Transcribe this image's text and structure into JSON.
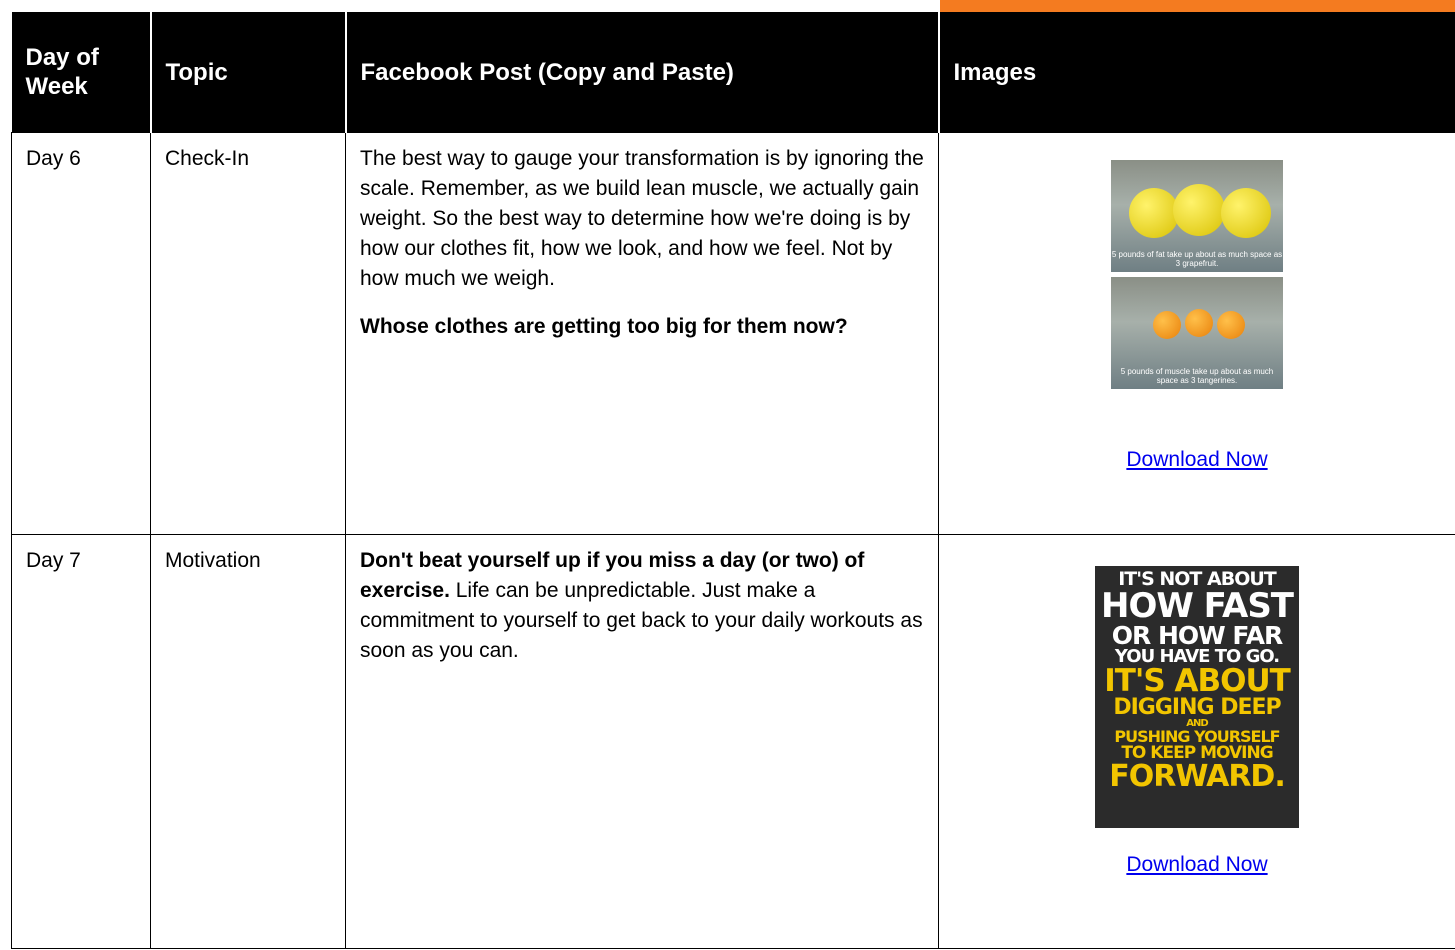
{
  "table": {
    "headers": [
      "Day of Week",
      "Topic",
      "Facebook Post (Copy and Paste)",
      "Images"
    ],
    "rows": [
      {
        "day": "Day 6",
        "topic": "Check-In",
        "post_para1": "The best way to gauge your transformation is by ignoring the scale. Remember, as we build lean muscle, we actually gain weight. So the best way to determine how we're doing is by how our clothes fit, how we look, and how we feel. Not by how much we weigh.",
        "post_para2_bold": "Whose clothes are getting too big for them now?",
        "image_caption_top": "5 pounds of fat take up about as much space as 3 grapefruit.",
        "image_caption_bottom": "5 pounds of muscle take up about as much space as 3 tangerines.",
        "link": "Download Now"
      },
      {
        "day": "Day 7",
        "topic": "Motivation",
        "post_bold": "Don't beat yourself up if you miss a day (or two) of exercise.",
        "post_rest": " Life can be unpredictable. Just make a commitment to yourself to get back to your daily workouts as soon as you can.",
        "poster_lines": [
          "IT'S NOT ABOUT",
          "HOW FAST",
          "OR HOW FAR",
          "YOU HAVE TO GO.",
          "IT'S ABOUT",
          "DIGGING DEEP",
          "AND",
          "PUSHING YOURSELF",
          "TO KEEP MOVING",
          "FORWARD."
        ],
        "link": "Download Now"
      }
    ]
  },
  "colors": {
    "accent": "#f47b20",
    "header_bg": "#000000",
    "poster_yellow": "#f2c500",
    "link": "#0000ee"
  }
}
